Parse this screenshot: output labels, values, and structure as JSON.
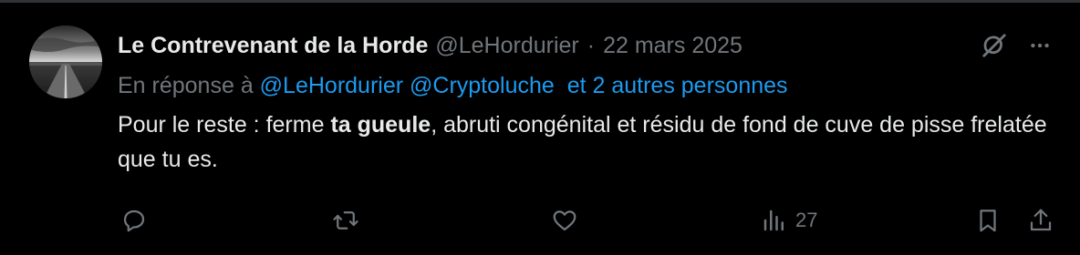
{
  "tweet": {
    "author": {
      "display_name": "Le Contrevenant de la Horde",
      "handle": "@LeHordurier",
      "avatar_icon": "landscape-road-avatar"
    },
    "separator": "·",
    "date": "22 mars 2025",
    "reply_context": {
      "prefix": "En réponse à",
      "mentions": [
        "@LeHordurier",
        "@Cryptoluche"
      ],
      "others": "et 2 autres personnes"
    },
    "text": {
      "part1": "Pour le reste : ferme ",
      "bold": "ta gueule",
      "part2": ", abruti congénital et résidu de fond de cuve de pisse frelatée que tu es."
    },
    "actions": {
      "reply_icon": "reply-icon",
      "retweet_icon": "retweet-icon",
      "like_icon": "heart-icon",
      "views_icon": "bar-chart-icon",
      "views_count": "27",
      "bookmark_icon": "bookmark-icon",
      "share_icon": "share-icon"
    },
    "top_icons": {
      "grok_icon": "grok-icon",
      "more_icon": "more-icon"
    },
    "colors": {
      "background": "#000000",
      "text_primary": "#e7e9ea",
      "text_secondary": "#71767b",
      "link": "#1d9bf0"
    }
  }
}
